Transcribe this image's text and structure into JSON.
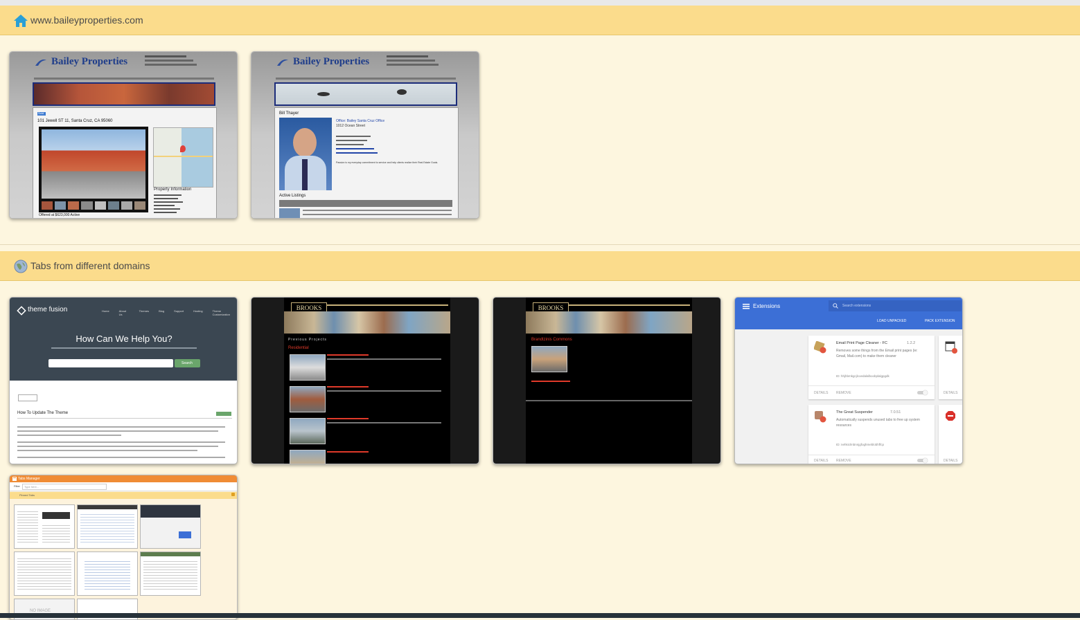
{
  "groups": [
    {
      "title": "www.baileyproperties.com",
      "icon": "home-icon",
      "tabs": [
        {
          "logo": "Bailey Properties",
          "heading": "101 Jewell ST 11, Santa Cruz, CA 95060",
          "section": "Property Information",
          "footer": "Offered at $623,000 Active",
          "badge": "Sold"
        },
        {
          "logo": "Bailey Properties",
          "heading": "Bill Thayer",
          "section": "Active Listings",
          "office": "Office: Bailey Santa Cruz Office",
          "address": "1012 Ocean Street",
          "bullet": "Passion is my everyday commitment to service and help clients realize their Real Estate Goals."
        }
      ]
    },
    {
      "title": "Tabs from different domains",
      "icon": "globe-icon",
      "tabs": [
        {
          "brand": "theme fusion",
          "nav": [
            "Home",
            "About Us",
            "Themes",
            "Blog",
            "Support",
            "Hosting",
            "Theme Customization"
          ],
          "headline": "How Can We Help You?",
          "search_button": "Search",
          "article_title": "How To Update The Theme"
        },
        {
          "logo": "BROOKS",
          "section": "Previous Projects",
          "category": "Residential"
        },
        {
          "logo": "BROOKS",
          "section": "Brandtzinis Commons"
        },
        {
          "title": "Extensions",
          "search_placeholder": "Search extensions",
          "actions": [
            "LOAD UNPACKED",
            "PACK EXTENSION"
          ],
          "cards": [
            {
              "name": "Email Print Page Cleaner - FC",
              "version": "1.2.2",
              "desc": "Removes some things from the Email print pages (ie: Gmail, Mail.com) to make them cleaner",
              "id": "ID: hhjhbmkgcjlcoedalalboobplalgpgdk",
              "details": "DETAILS",
              "remove": "REMOVE"
            },
            {
              "name": "The Great Suspender",
              "version": "7.0.51",
              "desc": "Automatically suspends unused tabs to free up system resources",
              "id": "ID: nehkiclmbnnjgfoghmeblobhffcp",
              "details": "DETAILS",
              "remove": "REMOVE"
            }
          ],
          "right_details": "DETAILS"
        },
        {
          "title": "Tabs Manager",
          "filter_label": "Filter",
          "filter_placeholder": "Type here...",
          "pinned": "Pinned Tabs",
          "no_image": "NO IMAGE"
        }
      ]
    }
  ],
  "colors": {
    "header_bg": "#fbdc8c",
    "body_bg": "#fdf6df",
    "accent_blue": "#3c6fd6"
  }
}
